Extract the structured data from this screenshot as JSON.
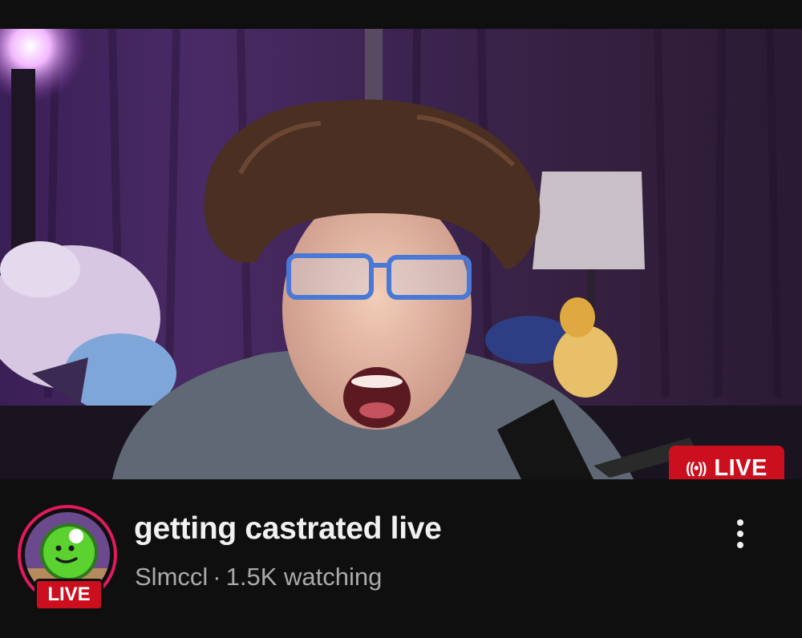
{
  "video": {
    "live_badge_label": "LIVE",
    "live_icon": "broadcast-icon",
    "live_icon_glyph": "((•))"
  },
  "stream": {
    "title": "getting castrated live",
    "channel_name": "Slmccl",
    "separator": "·",
    "viewers": "1.5K watching"
  },
  "avatar": {
    "live_label": "LIVE",
    "ring_color": "#e01a5c"
  },
  "menu": {
    "icon": "more-vert-icon"
  },
  "colors": {
    "background": "#0f0f0f",
    "live_red": "#cc0f1f",
    "title_text": "#f1f1f1",
    "meta_text": "#aaaaaa"
  }
}
